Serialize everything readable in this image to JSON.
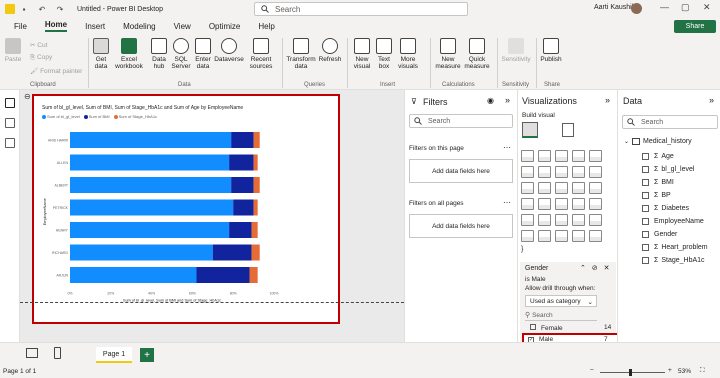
{
  "titlebar": {
    "doc_title": "Untitled - Power BI Desktop",
    "search_placeholder": "Search",
    "user_name": "Aarti Kaushik"
  },
  "menu": {
    "items": [
      "File",
      "Home",
      "Insert",
      "Modeling",
      "View",
      "Optimize",
      "Help"
    ],
    "active": "Home",
    "share_label": "Share"
  },
  "ribbon": {
    "clipboard": {
      "paste": "Paste",
      "cut": "Cut",
      "copy": "Copy",
      "format_painter": "Format painter",
      "label": "Clipboard"
    },
    "data": {
      "get_data": "Get data",
      "excel": "Excel workbook",
      "datahub": "Data hub",
      "sql": "SQL Server",
      "enter": "Enter data",
      "dataverse": "Dataverse",
      "recent": "Recent sources",
      "label": "Data"
    },
    "queries": {
      "transform": "Transform data",
      "refresh": "Refresh",
      "label": "Queries"
    },
    "insert": {
      "visual": "New visual",
      "textbox": "Text box",
      "more": "More visuals",
      "label": "Insert"
    },
    "calculations": {
      "measure": "New measure",
      "quick": "Quick measure",
      "label": "Calculations"
    },
    "sensitivity": {
      "btn": "Sensitivity",
      "label": "Sensitivity"
    },
    "share": {
      "publish": "Publish",
      "label": "Share"
    }
  },
  "chart_data": {
    "type": "bar",
    "title": "Sum of bl_gl_level, Sum of BMI, Sum of Stage_HbA1c and Sum of Age by EmployeeName",
    "categories": [
      "ANIS HARRI",
      "ALLEN",
      "ALBERT",
      "PETRICK",
      "HENRY",
      "RICHARD",
      "ARJUN"
    ],
    "series": [
      {
        "name": "Sum of bl_gl_level",
        "color": "#118dff",
        "values": [
          79,
          78,
          79,
          80,
          78,
          70,
          62
        ]
      },
      {
        "name": "Sum of BMI",
        "color": "#12239e",
        "values": [
          11,
          12,
          11,
          10,
          11,
          19,
          26
        ]
      },
      {
        "name": "Sum of Stage_HbA1c",
        "color": "#e66c37",
        "values": [
          3,
          2,
          3,
          2,
          3,
          4,
          4
        ]
      }
    ],
    "xticks": [
      "0%",
      "20%",
      "40%",
      "60%",
      "80%",
      "100%"
    ],
    "xlabel": "Sum of bl_gl_level, Sum of BMI and Sum of Stage_HbA1c",
    "ylabel": "EmployeeName",
    "xlim": [
      0,
      100
    ]
  },
  "filters": {
    "title": "Filters",
    "search": "Search",
    "this_page": "Filters on this page",
    "all_pages": "Filters on all pages",
    "add_fields": "Add data fields here"
  },
  "viz": {
    "title": "Visualizations",
    "build_visual": "Build visual",
    "filter_card": {
      "field": "Gender",
      "value": "is Male",
      "drill": "Allow drill through when:",
      "used_as": "Used as category",
      "search": "Search",
      "options": [
        {
          "label": "Female",
          "count": "14",
          "checked": false
        },
        {
          "label": "Male",
          "count": "7",
          "checked": true
        }
      ]
    }
  },
  "data": {
    "title": "Data",
    "search": "Search",
    "table": "Medical_history",
    "fields": [
      "Age",
      "bl_gl_level",
      "BMI",
      "BP",
      "Diabetes",
      "EmployeeName",
      "Gender",
      "Heart_problem",
      "Stage_HbA1c"
    ],
    "sigma": [
      true,
      true,
      true,
      true,
      true,
      false,
      false,
      true,
      true
    ]
  },
  "pages": {
    "tab": "Page 1",
    "add": "+"
  },
  "status": {
    "page": "Page 1 of 1",
    "zoom": "53%"
  }
}
